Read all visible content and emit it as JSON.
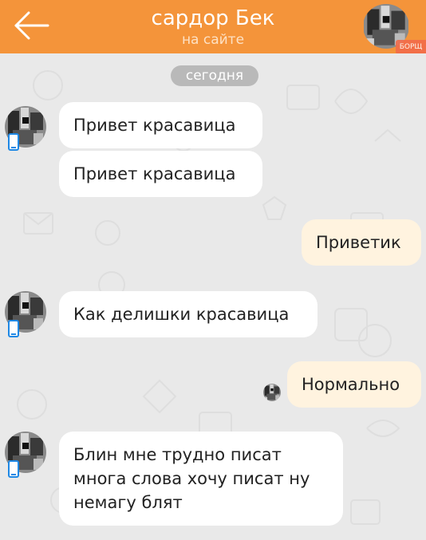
{
  "header": {
    "contact_name": "сардор Бек",
    "status": "на сайте",
    "watermark": "БОРЩ",
    "back_icon": "arrow-left-icon",
    "accent_color": "#f4943a"
  },
  "chat": {
    "date_label": "сегодня",
    "messages": [
      {
        "direction": "in",
        "text": "Привет красавица"
      },
      {
        "direction": "in",
        "text": "Привет красавица"
      },
      {
        "direction": "out",
        "text": "Приветик"
      },
      {
        "direction": "in",
        "text": "Как делишки красавица"
      },
      {
        "direction": "out",
        "text": "Нормально"
      },
      {
        "direction": "in",
        "lines": [
          "Блин мне трудно писат",
          "многа слова хочу писат ну",
          "немагу блят"
        ]
      }
    ]
  },
  "icons": {
    "mobile": "mobile-phone-icon",
    "read_receipt": "read-avatar-icon"
  }
}
